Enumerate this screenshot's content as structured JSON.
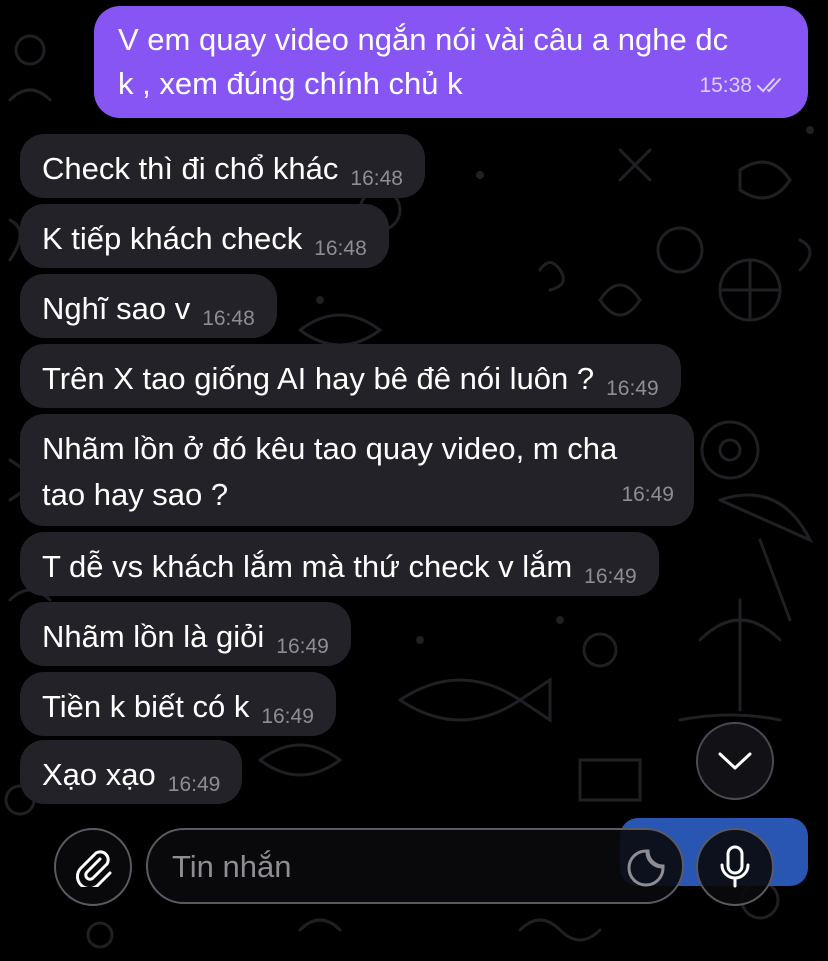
{
  "sent_message": {
    "text_line1": "V em quay video ngắn nói vài câu a nghe dc",
    "text_line2": "k , xem đúng chính chủ k",
    "time": "15:38",
    "status_icon": "double-check-icon"
  },
  "received_messages": [
    {
      "text": "Check thì đi chổ khác",
      "time": "16:48"
    },
    {
      "text": "K tiếp khách check",
      "time": "16:48"
    },
    {
      "text": "Nghĩ sao v",
      "time": "16:48"
    },
    {
      "text": "Trên X tao giống AI hay bê đê nói luôn ?",
      "time": "16:49"
    },
    {
      "text_line1": "Nhãm lồn ở đó kêu tao quay video, m cha",
      "text_line2": "tao hay sao ?",
      "time": "16:49"
    },
    {
      "text": "T dễ vs khách lắm mà thứ check v lắm",
      "time": "16:49"
    },
    {
      "text": "Nhãm lồn là giỏi",
      "time": "16:49"
    },
    {
      "text": "Tiền k biết có k",
      "time": "16:49"
    },
    {
      "text": "Xạo xạo",
      "time": "16:49"
    }
  ],
  "composer": {
    "placeholder": "Tin nhắn",
    "attach_icon": "paperclip-icon",
    "sticker_icon": "sticker-icon",
    "mic_icon": "microphone-icon"
  },
  "scroll_button_icon": "chevron-down-icon",
  "colors": {
    "sent_bubble": "#8655f4",
    "received_bubble": "#232228",
    "background": "#000000",
    "timestamp": "#8e8d93"
  }
}
